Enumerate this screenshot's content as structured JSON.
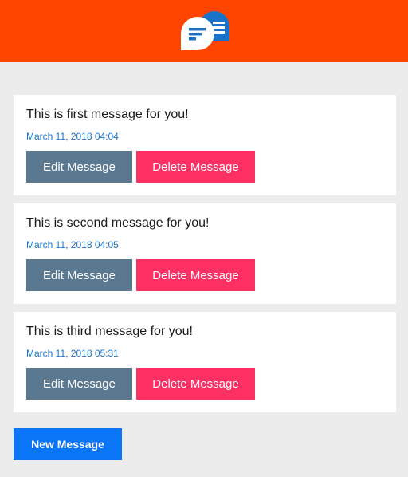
{
  "header": {
    "logo_icon": "chat-bubbles-icon",
    "brand_color": "#ff4500"
  },
  "messages": [
    {
      "text": "This is first message for you!",
      "date": "March 11, 2018 04:04",
      "edit_label": "Edit Message",
      "delete_label": "Delete Message"
    },
    {
      "text": "This is second message for you!",
      "date": "March 11, 2018 04:05",
      "edit_label": "Edit Message",
      "delete_label": "Delete Message"
    },
    {
      "text": "This is third message for you!",
      "date": "March 11, 2018 05:31",
      "edit_label": "Edit Message",
      "delete_label": "Delete Message"
    }
  ],
  "new_message_label": "New Message",
  "colors": {
    "edit_button": "#5b7891",
    "delete_button": "#fe2f63",
    "new_button": "#0a75f6",
    "date_text": "#1a73c8"
  }
}
